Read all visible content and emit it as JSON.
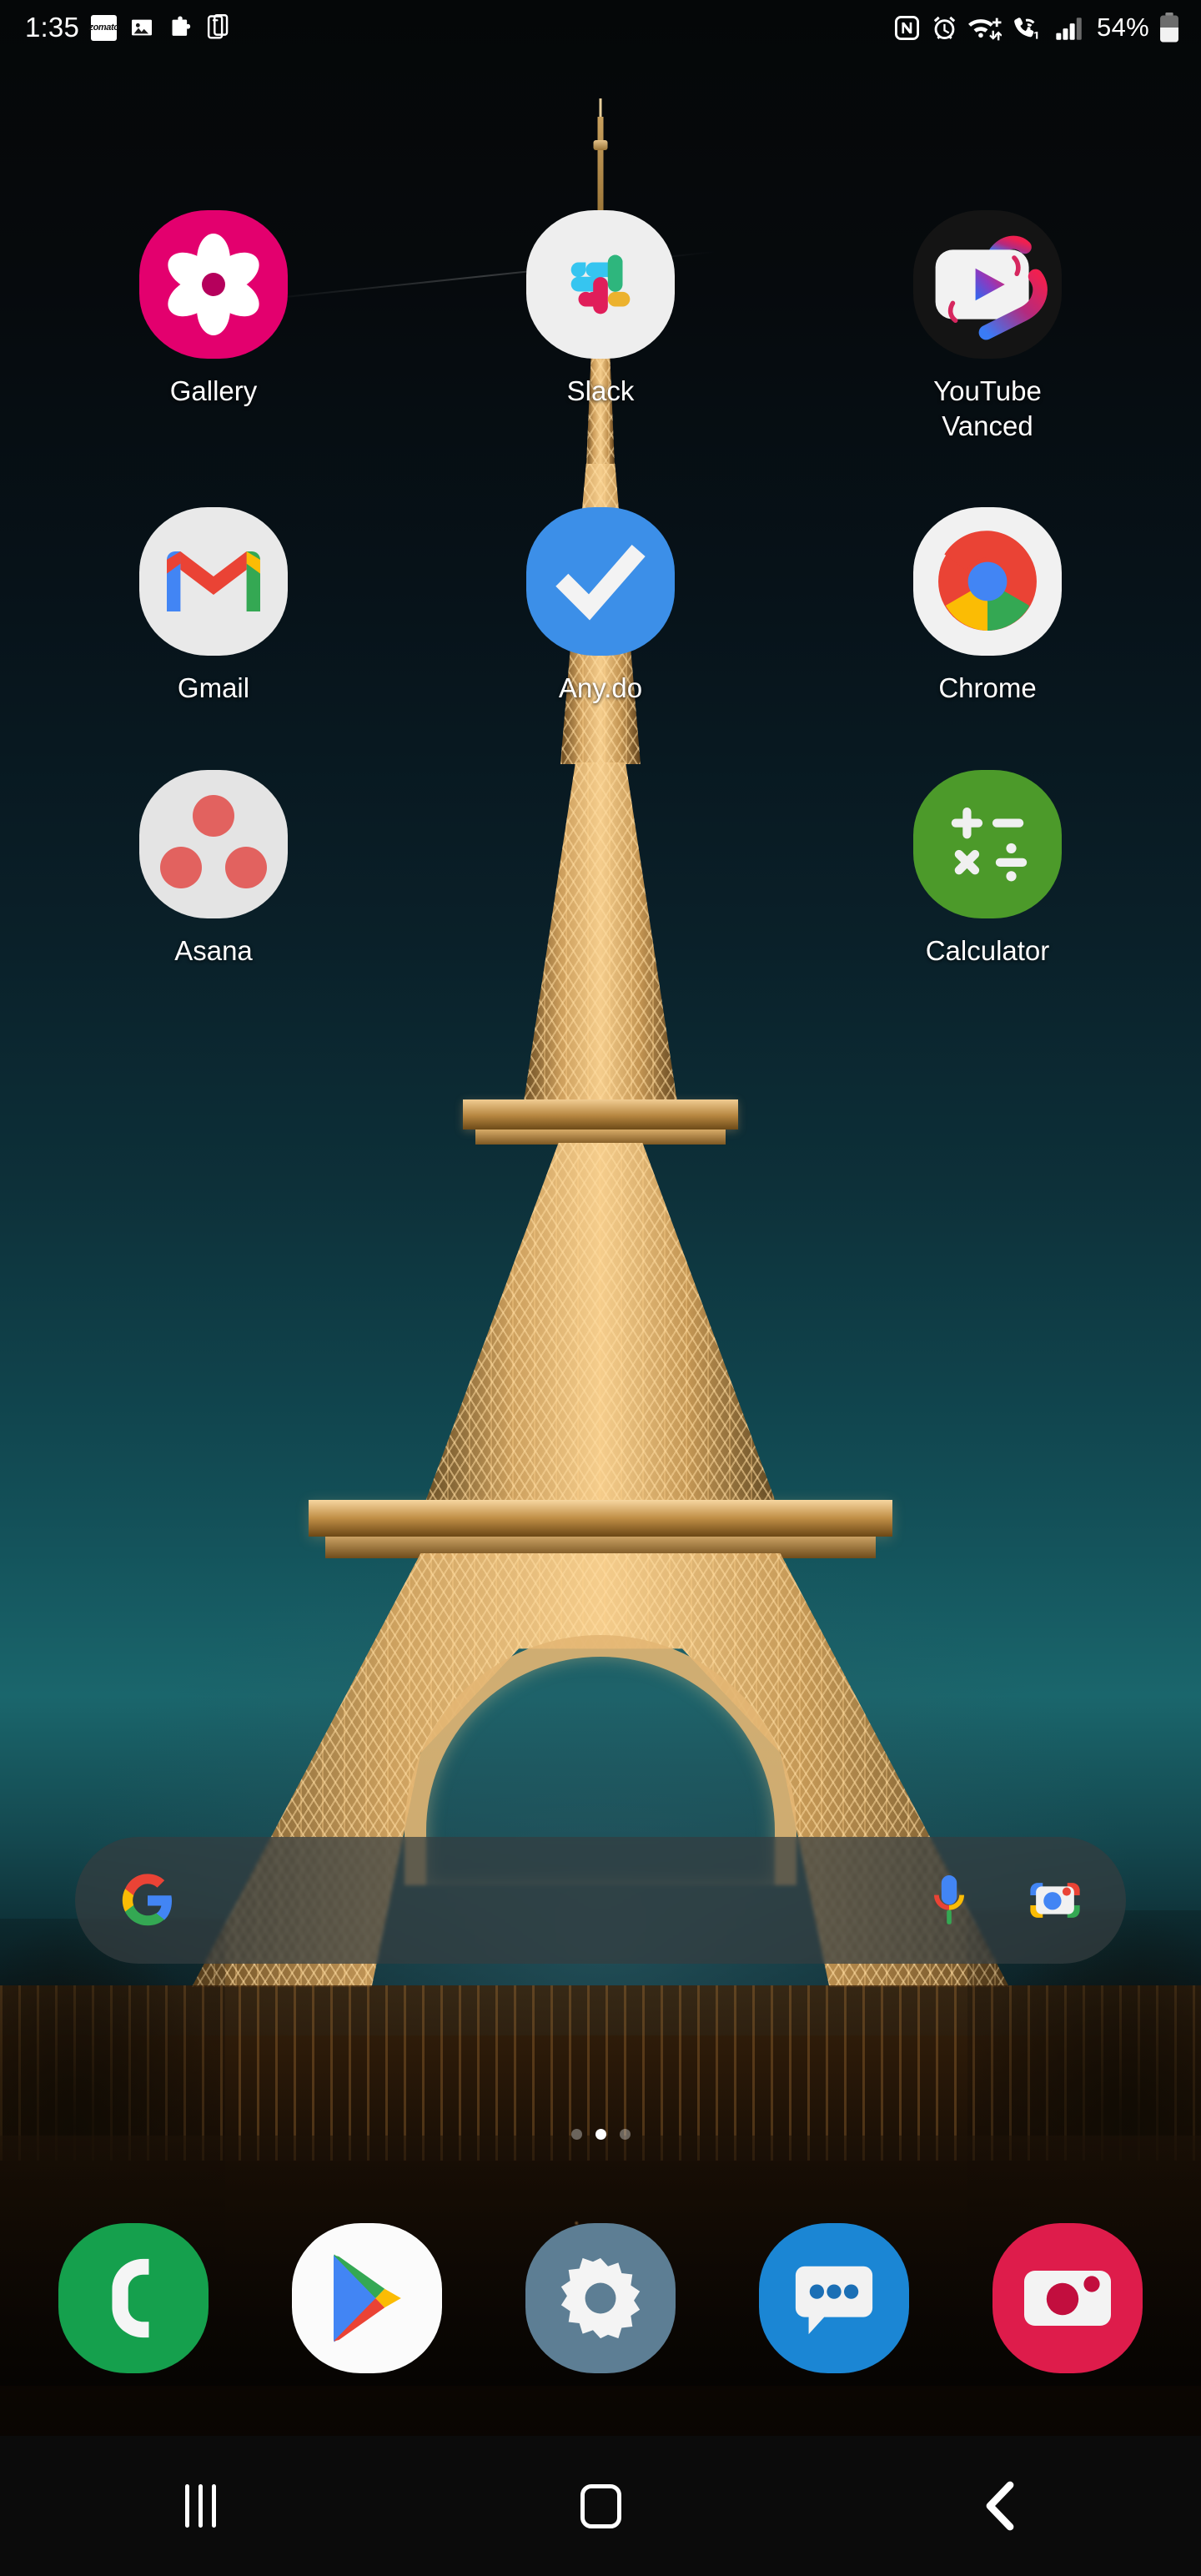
{
  "status_bar": {
    "clock": "1:35",
    "battery_percent": "54%",
    "left_icons": [
      {
        "name": "zomato-notification-icon",
        "label": "zomato"
      },
      {
        "name": "image-notification-icon",
        "label": ""
      },
      {
        "name": "puzzle-notification-icon",
        "label": ""
      },
      {
        "name": "screen-mirror-notification-icon",
        "label": ""
      }
    ],
    "right_icons": [
      {
        "name": "nfc-icon"
      },
      {
        "name": "alarm-icon"
      },
      {
        "name": "wifi-plus-icon"
      },
      {
        "name": "wifi-calling-icon",
        "badge": "1"
      },
      {
        "name": "signal-bars-icon",
        "bars": 3,
        "total": 4
      },
      {
        "name": "battery-icon",
        "level": 54
      }
    ]
  },
  "home_screen": {
    "apps": [
      {
        "label": "Gallery",
        "icon": "gallery-icon",
        "bg": "#E3006E"
      },
      {
        "label": "Slack",
        "icon": "slack-icon",
        "bg": "#EEEEEE"
      },
      {
        "label": "YouTube\nVanced",
        "icon": "youtube-vanced-icon",
        "bg": "#121212"
      },
      {
        "label": "Gmail",
        "icon": "gmail-icon",
        "bg": "#E8E8E8"
      },
      {
        "label": "Any.do",
        "icon": "anydo-icon",
        "bg": "#3C8FE8"
      },
      {
        "label": "Chrome",
        "icon": "chrome-icon",
        "bg": "#F1F1F1"
      },
      {
        "label": "Asana",
        "icon": "asana-icon",
        "bg": "#E4E4E4"
      },
      {
        "label": "",
        "icon": "empty-slot",
        "bg": "transparent"
      },
      {
        "label": "Calculator",
        "icon": "calculator-icon",
        "bg": "#4C9A2A"
      }
    ]
  },
  "search_widget": {
    "name": "google-search-bar",
    "google_logo": "google-g-icon",
    "mic": "microphone-icon",
    "lens": "google-lens-icon",
    "query": "",
    "placeholder": ""
  },
  "page_indicator": {
    "pages": 3,
    "active_index": 1
  },
  "dock": {
    "apps": [
      {
        "label": "Phone",
        "icon": "phone-icon",
        "bg": "#15A04D"
      },
      {
        "label": "Play Store",
        "icon": "play-store-icon",
        "bg": "#FBFBFB"
      },
      {
        "label": "Settings",
        "icon": "settings-icon",
        "bg": "#5D7E94"
      },
      {
        "label": "Messages",
        "icon": "messages-icon",
        "bg": "#1B86D4"
      },
      {
        "label": "Camera",
        "icon": "camera-icon",
        "bg": "#DE1C4B"
      }
    ]
  },
  "nav_bar": {
    "recents_label": "Recents",
    "home_label": "Home",
    "back_label": "Back"
  },
  "colors": {
    "gallery_pink": "#E3006E",
    "anydo_blue": "#3C8FE8",
    "calculator_green": "#4C9A2A",
    "phone_green": "#15A04D",
    "settings_slate": "#5D7E94",
    "messages_blue": "#1B86D4",
    "camera_crimson": "#DE1C4B",
    "asana_coral": "#E2625F"
  }
}
